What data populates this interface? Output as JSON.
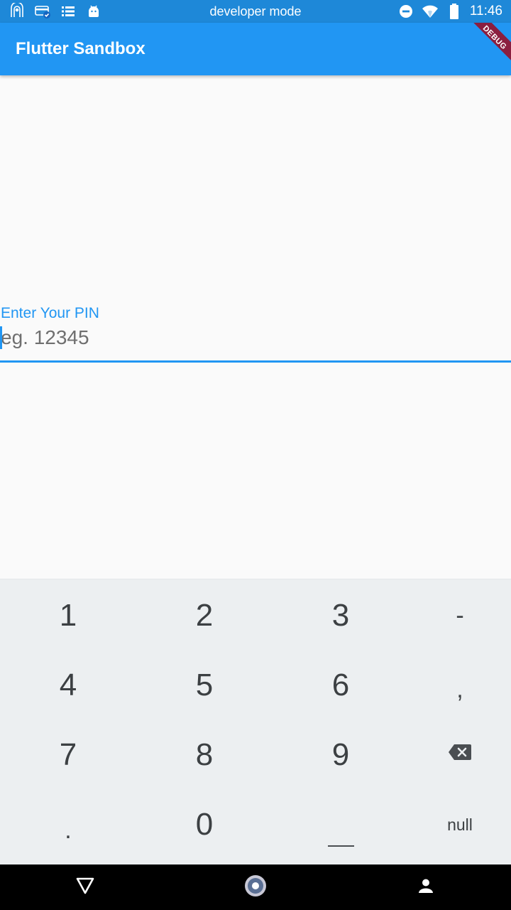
{
  "status_bar": {
    "center_text": "developer mode",
    "time": "11:46",
    "icons_left": [
      "cast-icon",
      "payment-card-icon",
      "list-icon",
      "android-icon"
    ],
    "icons_right": [
      "do-not-disturb-icon",
      "wifi-icon",
      "battery-icon"
    ]
  },
  "app_bar": {
    "title": "Flutter Sandbox",
    "color": "#2196f3",
    "debug_banner": "DEBUG"
  },
  "pin_field": {
    "label": "Enter Your PIN",
    "placeholder": "eg. 12345",
    "value": "",
    "accent": "#2196f3"
  },
  "keyboard": {
    "rows": [
      [
        "1",
        "2",
        "3",
        "-"
      ],
      [
        "4",
        "5",
        "6",
        ","
      ],
      [
        "7",
        "8",
        "9",
        "backspace"
      ],
      [
        ".",
        "0",
        "space",
        "null"
      ]
    ]
  },
  "nav_bar": {
    "buttons": [
      "back-icon",
      "home-icon",
      "account-icon"
    ]
  }
}
